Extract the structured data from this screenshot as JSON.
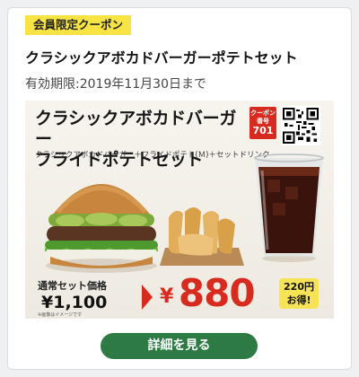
{
  "coupon": {
    "badge": "会員限定クーポン",
    "title": "クラシックアボカドバーガーポテトセット",
    "expiry": "有効期限:2019年11月30日まで"
  },
  "promo": {
    "title_line1": "クラシックアボカドバーガー",
    "title_line2": "フライドポテトセット",
    "subtitle": "クラシックアボカドバーガー＋フライドポテト(Ｍ)＋セットドリンク",
    "code_label": "クーポン番号",
    "code_number": "701",
    "regular_label": "通常セット価格",
    "regular_price": "¥1,100",
    "sale_currency": "¥",
    "sale_price": "880",
    "savings_amount": "220円",
    "savings_text": "お得!",
    "footnote": "※画像はイメージです"
  },
  "actions": {
    "detail_label": "詳細を見る"
  },
  "colors": {
    "accent_red": "#d82b1f",
    "badge_yellow": "#f7e343",
    "button_green": "#2e7a44"
  }
}
